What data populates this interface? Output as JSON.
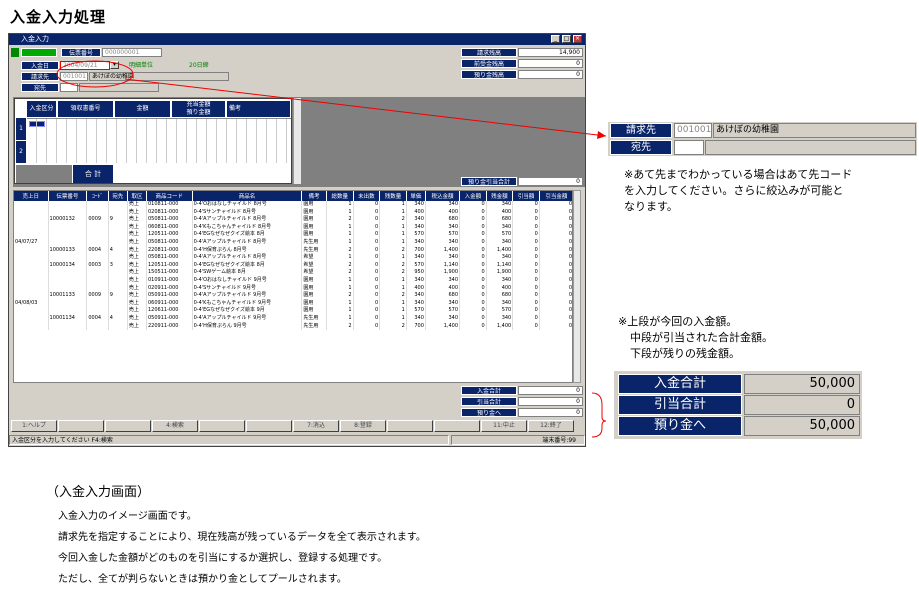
{
  "page_title": "入金入力処理",
  "window": {
    "title": "入金入力",
    "header": {
      "slip_no_label": "伝票番号",
      "slip_no_value": "000000001",
      "deposit_date_label": "入金日",
      "deposit_date_value": "2004/09/21",
      "billing_label": "請求先",
      "billing_code": "001001",
      "billing_name": "あけぼの幼稚園",
      "dest_label": "宛先",
      "detail_unit": "明細単位",
      "rows_label": "20日締",
      "balance_label": "請求残高",
      "balance_value": "14,900",
      "advance_label": "前受金残高",
      "advance_value": "0",
      "deposit_bal_label": "預り金残高",
      "deposit_bal_value": "0"
    },
    "entry_grid": {
      "col_kubun": "入金区分",
      "col_receipt": "領収書番号",
      "col_amount": "金額",
      "col_allocate": "充当金額",
      "col_deposit": "預り金額",
      "col_memo": "備考",
      "row1": "1",
      "row2": "2",
      "total_label": "合 計",
      "deposit_total_label": "預り金引当合計",
      "deposit_total_value": "0"
    },
    "list": {
      "headers": [
        "売上日",
        "伝票番号",
        "ｺｰﾄﾞ",
        "宛先",
        "取区",
        "商品コード",
        "商品名",
        "備考",
        "総数量",
        "未出数",
        "残数量",
        "単価",
        "税込金額",
        "入金額",
        "残金額",
        "引当額",
        "引当金額"
      ],
      "rows": [
        [
          "",
          "",
          "",
          "",
          "売上",
          "010811-000",
          "0-4'Oおはなしチャイルド 8月号",
          "園用",
          "1",
          "0",
          "1",
          "340",
          "340",
          "0",
          "340",
          "0",
          "0"
        ],
        [
          "",
          "",
          "",
          "",
          "売上",
          "020811-000",
          "0-4'Sサンチャイルド 8月号",
          "園用",
          "1",
          "0",
          "1",
          "400",
          "400",
          "0",
          "400",
          "0",
          "0"
        ],
        [
          "",
          "10000132",
          "0009",
          "9",
          "売上",
          "050811-000",
          "0-4'Aアップルチャイルド 8月号",
          "園用",
          "2",
          "0",
          "2",
          "340",
          "680",
          "0",
          "680",
          "0",
          "0"
        ],
        [
          "",
          "",
          "",
          "",
          "売上",
          "060811-000",
          "0-4'Kもこちゃんチャイルド 8月号",
          "園用",
          "1",
          "0",
          "1",
          "340",
          "340",
          "0",
          "340",
          "0",
          "0"
        ],
        [
          "",
          "",
          "",
          "",
          "売上",
          "120511-000",
          "0-4'EGなぜなぜクイズ絵本 8月",
          "園用",
          "1",
          "0",
          "1",
          "570",
          "570",
          "0",
          "570",
          "0",
          "0"
        ],
        [
          "04/07/27",
          "",
          "",
          "",
          "売上",
          "050811-000",
          "0-4'Aアップルチャイルド 8月号",
          "先生用",
          "1",
          "0",
          "1",
          "340",
          "340",
          "0",
          "340",
          "0",
          "0"
        ],
        [
          "",
          "10000133",
          "0004",
          "4",
          "売上",
          "220811-000",
          "0-4'H保育ぷらん 8月号",
          "先生用",
          "2",
          "0",
          "2",
          "700",
          "1,400",
          "0",
          "1,400",
          "0",
          "0"
        ],
        [
          "",
          "",
          "",
          "",
          "売上",
          "050811-000",
          "0-4'Aアップルチャイルド 8月号",
          "希望",
          "1",
          "0",
          "1",
          "340",
          "340",
          "0",
          "340",
          "0",
          "0"
        ],
        [
          "",
          "10000134",
          "0003",
          "3",
          "売上",
          "120511-000",
          "0-4'EGなぜなぜクイズ絵本 8月",
          "希望",
          "2",
          "0",
          "2",
          "570",
          "1,140",
          "0",
          "1,140",
          "0",
          "0"
        ],
        [
          "",
          "",
          "",
          "",
          "売上",
          "150511-000",
          "0-4'SWゲーム絵本 8月",
          "希望",
          "2",
          "0",
          "2",
          "950",
          "1,900",
          "0",
          "1,900",
          "0",
          "0"
        ],
        [
          "",
          "",
          "",
          "",
          "売上",
          "010911-000",
          "0-4'Oおはなしチャイルド 9月号",
          "園用",
          "1",
          "0",
          "1",
          "340",
          "340",
          "0",
          "340",
          "0",
          "0"
        ],
        [
          "",
          "",
          "",
          "",
          "売上",
          "020911-000",
          "0-4'Sサンチャイルド 9月号",
          "園用",
          "1",
          "0",
          "1",
          "400",
          "400",
          "0",
          "400",
          "0",
          "0"
        ],
        [
          "",
          "10001133",
          "0009",
          "9",
          "売上",
          "050911-000",
          "0-4'Aアップルチャイルド 9月号",
          "園用",
          "2",
          "0",
          "2",
          "340",
          "680",
          "0",
          "680",
          "0",
          "0"
        ],
        [
          "04/08/03",
          "",
          "",
          "",
          "売上",
          "060911-000",
          "0-4'Kもこちゃんチャイルド 9月号",
          "園用",
          "1",
          "0",
          "1",
          "340",
          "340",
          "0",
          "340",
          "0",
          "0"
        ],
        [
          "",
          "",
          "",
          "",
          "売上",
          "120611-000",
          "0-4'EGなぜなぜクイズ絵本 9月",
          "園用",
          "1",
          "0",
          "1",
          "570",
          "570",
          "0",
          "570",
          "0",
          "0"
        ],
        [
          "",
          "10001134",
          "0004",
          "4",
          "売上",
          "050911-000",
          "0-4'Aアップルチャイルド 9月号",
          "先生用",
          "1",
          "0",
          "1",
          "340",
          "340",
          "0",
          "340",
          "0",
          "0"
        ],
        [
          "",
          "",
          "",
          "",
          "売上",
          "220911-000",
          "0-4'H保育ぷらん 9月号",
          "先生用",
          "2",
          "0",
          "2",
          "700",
          "1,400",
          "0",
          "1,400",
          "0",
          "0"
        ]
      ]
    },
    "totals": {
      "in_label": "入金合計",
      "in_value": "0",
      "alloc_label": "引当合計",
      "alloc_value": "0",
      "to_deposit_label": "預り金へ",
      "to_deposit_value": "0"
    },
    "fkeys": [
      "1:ヘルプ",
      "",
      "",
      "4:検索",
      "",
      "",
      "7:消込",
      "8:登録",
      "",
      "",
      "11:中止",
      "12:終了"
    ],
    "status_left": "入金区分を入力してください F4:検索",
    "status_right": "端末番号:99"
  },
  "zoom": {
    "billing_label": "請求先",
    "billing_code": "001001",
    "billing_name": "あけぼの幼稚園",
    "dest_label": "宛先"
  },
  "note1": [
    "※あて先までわかっている場合はあて先コード",
    "を入力してください。さらに絞込みが可能と",
    "なります。"
  ],
  "note2": [
    "※上段が今回の入金額。",
    "中段が引当された合計金額。",
    "下段が残りの残金額。"
  ],
  "summary": {
    "in_label": "入金合計",
    "in_value": "50,000",
    "alloc_label": "引当合計",
    "alloc_value": "0",
    "deposit_label": "預り金へ",
    "deposit_value": "50,000"
  },
  "caption": "（入金入力画面）",
  "description": [
    "入金入力のイメージ画面です。",
    "請求先を指定することにより、現在残高が残っているデータを全て表示されます。",
    "今回入金した金額がどのものを引当にするか選択し、登録する処理です。",
    "ただし、全てが判らないときは預かり金としてプールされます。"
  ],
  "colors": {
    "navy": "#0a246a",
    "panel": "#d4d0c8",
    "accent_red": "#e00000"
  }
}
